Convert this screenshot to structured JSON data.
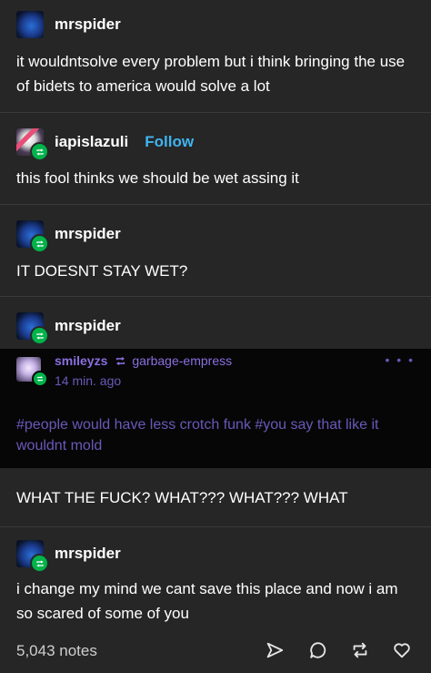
{
  "posts": [
    {
      "username": "mrspider",
      "text": "it wouldntsolve every problem but i think bringing the use of bidets to america would solve a lot"
    },
    {
      "username": "iapislazuli",
      "follow_label": "Follow",
      "text": "this fool thinks we should be wet assing it"
    },
    {
      "username": "mrspider",
      "text": "IT DOESNT STAY WET?"
    },
    {
      "username": "mrspider"
    },
    {
      "text": "WHAT THE FUCK? WHAT??? WHAT??? WHAT"
    },
    {
      "username": "mrspider",
      "text": "i change my mind we cant save this place and now i am so scared of some of you"
    }
  ],
  "embed": {
    "username": "smileyzs",
    "reblogged_from": "garbage-empress",
    "time": "14 min. ago",
    "menu": "• • •",
    "tags": "#people would have less crotch funk  #you say that like it wouldnt mold"
  },
  "footer": {
    "notes": "5,043 notes"
  },
  "colors": {
    "background": "#262626",
    "accent_follow": "#3fb4f0",
    "reblog_green": "#00b34a",
    "embed_purple": "#8a6fe0"
  },
  "icons": [
    "reblog-icon",
    "share-icon",
    "reply-icon",
    "reblog-button-icon",
    "like-icon",
    "more-icon"
  ]
}
